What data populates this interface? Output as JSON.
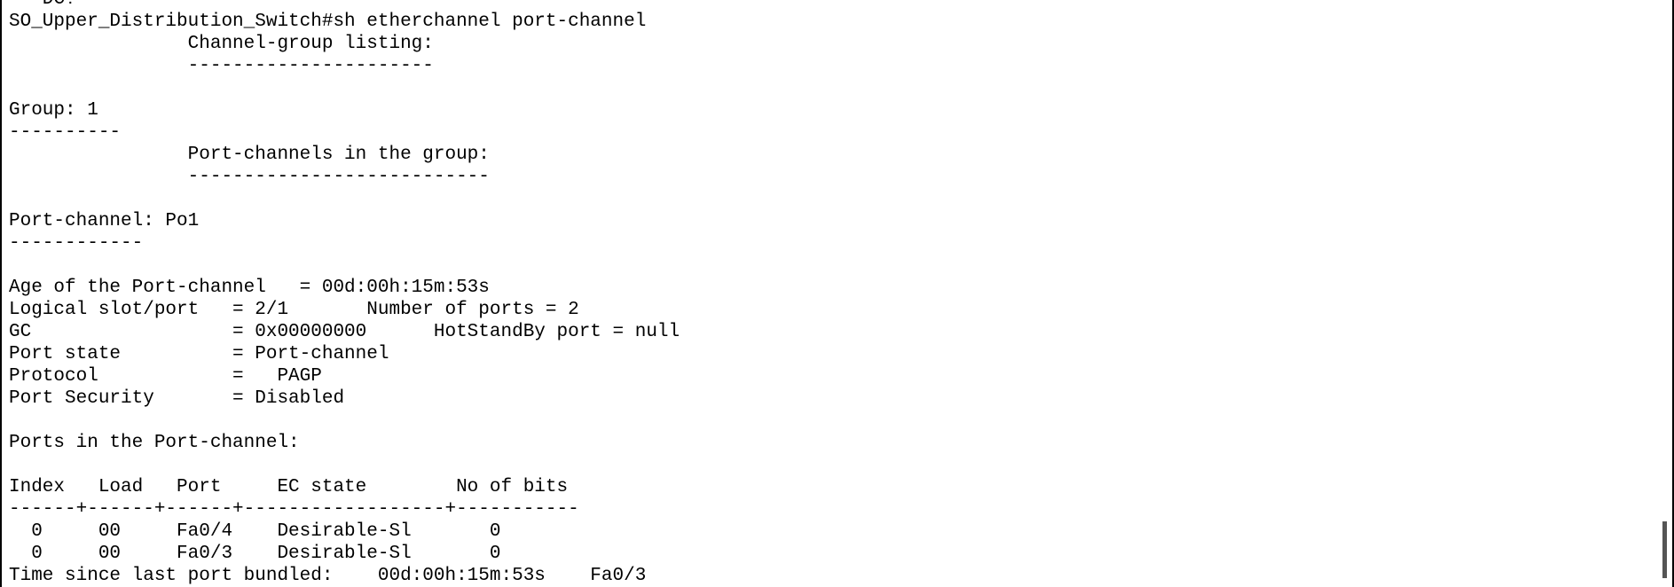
{
  "terminal": {
    "lines": [
      "  -DC!",
      "SO_Upper_Distribution_Switch#sh etherchannel port-channel",
      "                Channel-group listing:",
      "                ----------------------",
      "",
      "Group: 1",
      "----------",
      "                Port-channels in the group:",
      "                ---------------------------",
      "",
      "Port-channel: Po1",
      "------------",
      "",
      "Age of the Port-channel   = 00d:00h:15m:53s",
      "Logical slot/port   = 2/1       Number of ports = 2",
      "GC                  = 0x00000000      HotStandBy port = null",
      "Port state          = Port-channel",
      "Protocol            =   PAGP",
      "Port Security       = Disabled",
      "",
      "Ports in the Port-channel:",
      "",
      "Index   Load   Port     EC state        No of bits",
      "------+------+------+------------------+-----------",
      "  0     00     Fa0/4    Desirable-Sl       0",
      "  0     00     Fa0/3    Desirable-Sl       0",
      "Time since last port bundled:    00d:00h:15m:53s    Fa0/3"
    ]
  }
}
